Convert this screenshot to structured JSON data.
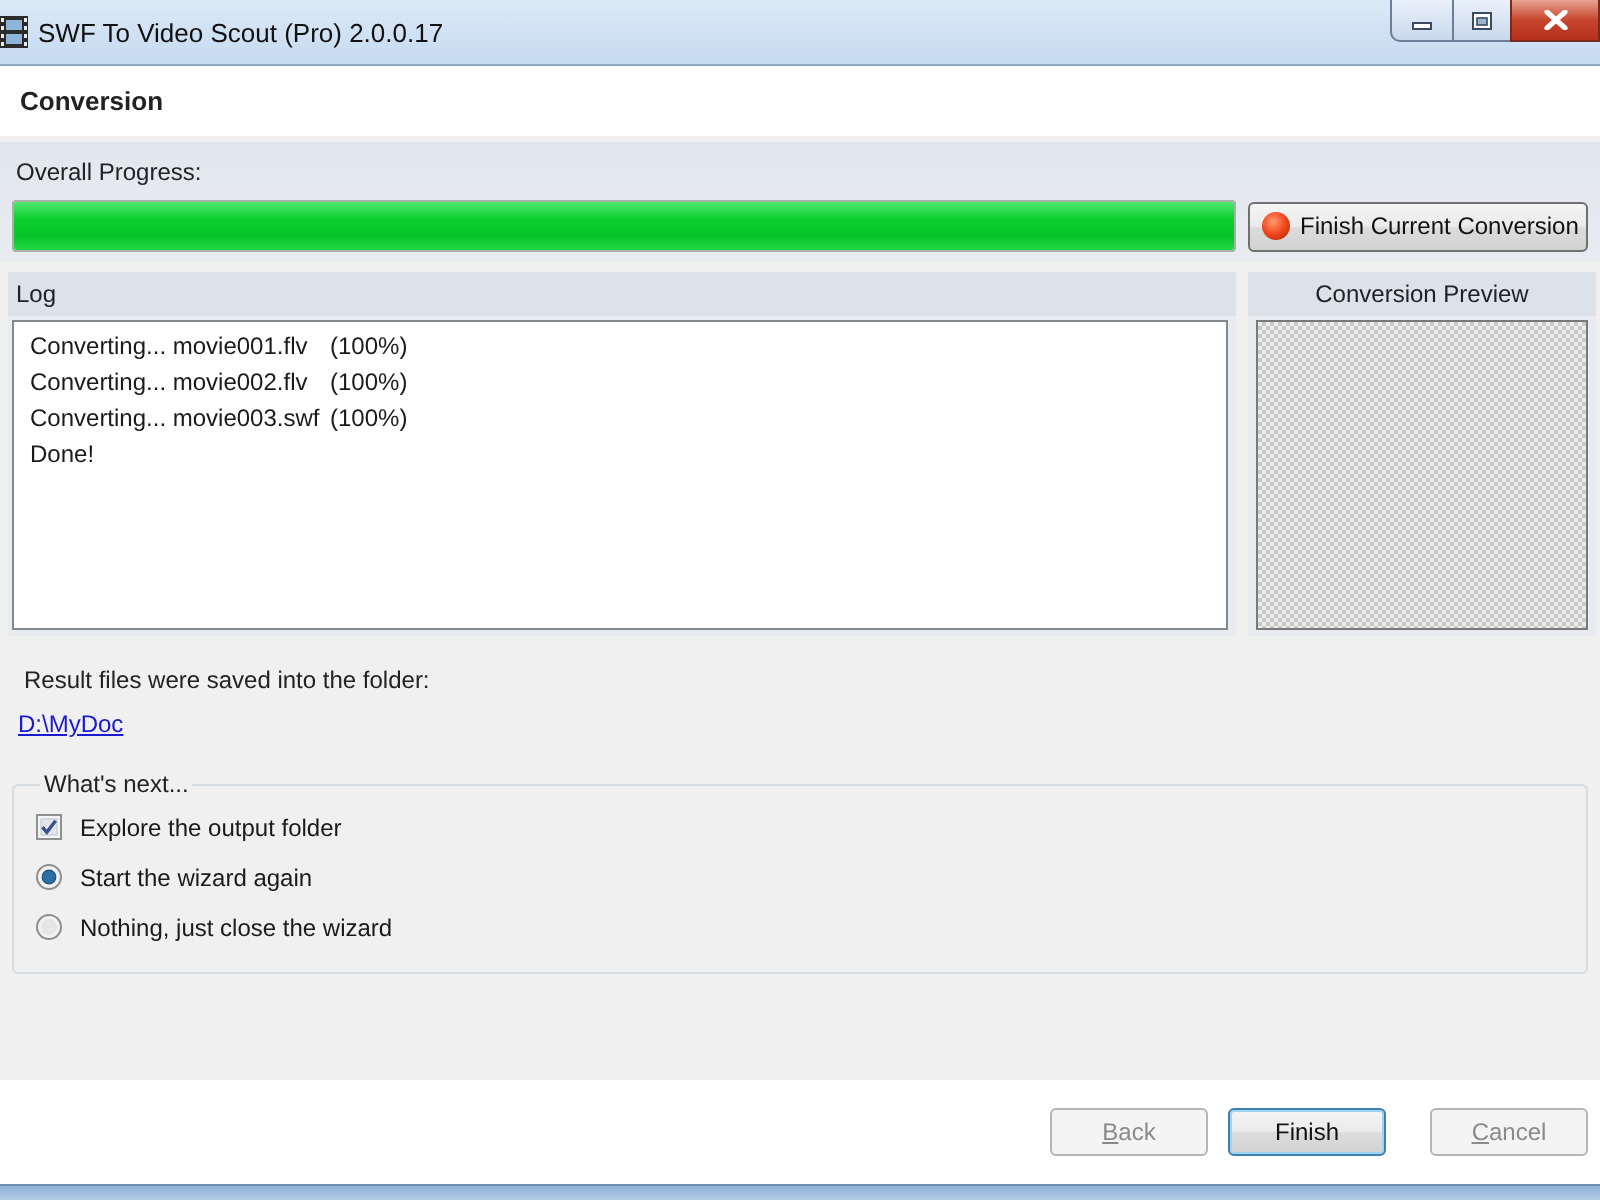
{
  "window": {
    "title": "SWF To Video Scout (Pro) 2.0.0.17"
  },
  "header": {
    "title": "Conversion"
  },
  "overall_progress": {
    "label": "Overall Progress:",
    "level": 1,
    "button": "Finish Current Conversion"
  },
  "log": {
    "label": "Log",
    "lines": [
      {
        "text": "Converting... movie001.flv",
        "percent": "(100%)"
      },
      {
        "text": "Converting... movie002.flv",
        "percent": "(100%)"
      },
      {
        "text": "Converting... movie003.swf",
        "percent": "(100%)"
      },
      {
        "text": "Done!"
      }
    ]
  },
  "preview": {
    "label": "Conversion Preview"
  },
  "result": {
    "text": "Result files were saved into the folder:",
    "link": "D:\\MyDoc"
  },
  "whats_next": {
    "label": "What's next...",
    "options": [
      {
        "kind": "checkbox",
        "label": "Explore the output folder",
        "checked": true
      },
      {
        "kind": "radio",
        "label": "Start the wizard again",
        "selected": true
      },
      {
        "kind": "radio",
        "label": "Nothing, just close the wizard",
        "selected": false
      }
    ]
  },
  "buttons": [
    {
      "label": "Back",
      "disabled": true,
      "default": false,
      "access_key_underlined": true
    },
    {
      "label": "Finish",
      "disabled": false,
      "default": true,
      "access_key_underlined": false
    },
    {
      "label": "Cancel",
      "disabled": true,
      "default": false,
      "access_key_underlined": true
    }
  ]
}
